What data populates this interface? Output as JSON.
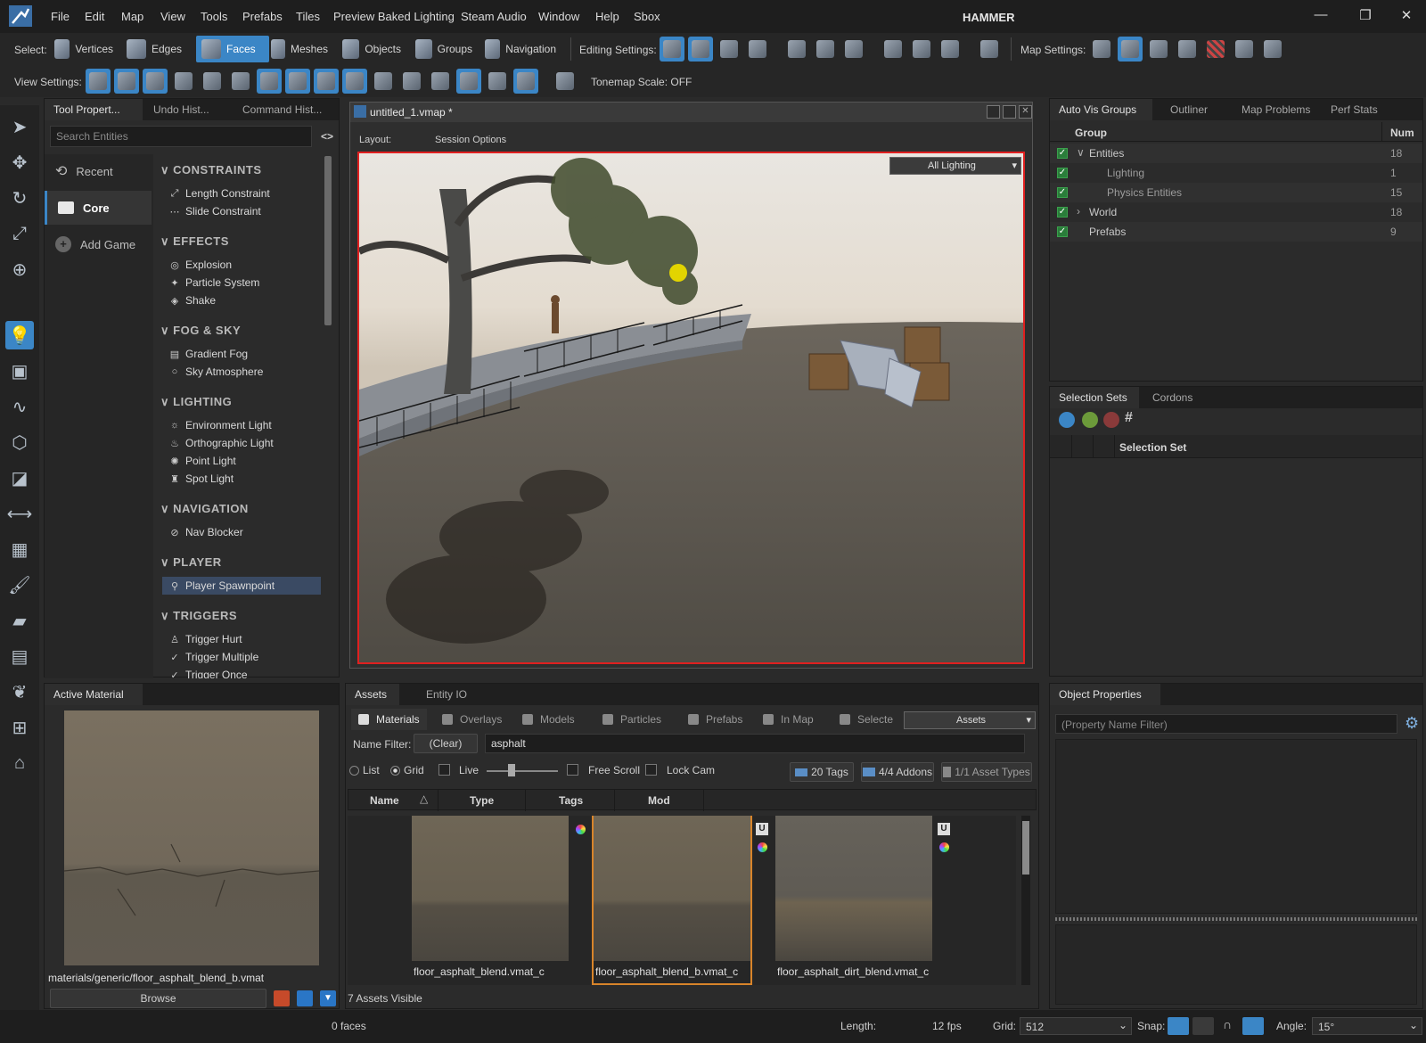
{
  "menubar": {
    "items": [
      "File",
      "Edit",
      "Map",
      "View",
      "Tools",
      "Prefabs",
      "Tiles",
      "Preview Baked Lighting",
      "Steam Audio",
      "Window",
      "Help",
      "Sbox"
    ],
    "title": "HAMMER",
    "win": {
      "min": "—",
      "max": "❐",
      "close": "✕"
    }
  },
  "toolbar1": {
    "select_label": "Select:",
    "select_modes": [
      {
        "label": "Vertices",
        "icon": "vertices-icon",
        "active": false
      },
      {
        "label": "Edges",
        "icon": "edges-icon",
        "active": false
      },
      {
        "label": "Faces",
        "icon": "faces-icon",
        "active": true
      },
      {
        "label": "Meshes",
        "icon": "meshes-icon",
        "active": false
      },
      {
        "label": "Objects",
        "icon": "objects-icon",
        "active": false
      },
      {
        "label": "Groups",
        "icon": "groups-icon",
        "active": false
      },
      {
        "label": "Navigation",
        "icon": "navigation-icon",
        "active": false
      }
    ],
    "editing_label": "Editing Settings:",
    "map_label": "Map Settings:"
  },
  "toolbar2": {
    "view_label": "View Settings:",
    "tonemap": "Tonemap Scale: OFF"
  },
  "left_panel": {
    "tabs": [
      "Tool Propert...",
      "Undo Hist...",
      "Command Hist..."
    ],
    "search_placeholder": "Search Entities",
    "categories": [
      {
        "label": "Recent",
        "icon": "clock-icon",
        "active": false
      },
      {
        "label": "Core",
        "icon": "folder-icon",
        "active": true
      },
      {
        "label": "Add Game",
        "icon": "plus-circle-icon",
        "active": false
      }
    ],
    "sections": [
      {
        "title": "CONSTRAINTS",
        "items": [
          {
            "label": "Length Constraint",
            "glyph": "⤢"
          },
          {
            "label": "Slide Constraint",
            "glyph": "⋯"
          }
        ]
      },
      {
        "title": "EFFECTS",
        "items": [
          {
            "label": "Explosion",
            "glyph": "◎"
          },
          {
            "label": "Particle System",
            "glyph": "✦"
          },
          {
            "label": "Shake",
            "glyph": "◈"
          }
        ]
      },
      {
        "title": "FOG & SKY",
        "items": [
          {
            "label": "Gradient Fog",
            "glyph": "▤"
          },
          {
            "label": "Sky Atmosphere",
            "glyph": "○"
          }
        ]
      },
      {
        "title": "LIGHTING",
        "items": [
          {
            "label": "Environment Light",
            "glyph": "☼"
          },
          {
            "label": "Orthographic Light",
            "glyph": "♨"
          },
          {
            "label": "Point Light",
            "glyph": "✺"
          },
          {
            "label": "Spot Light",
            "glyph": "♜"
          }
        ]
      },
      {
        "title": "NAVIGATION",
        "items": [
          {
            "label": "Nav Blocker",
            "glyph": "⊘"
          }
        ]
      },
      {
        "title": "PLAYER",
        "items": [
          {
            "label": "Player Spawnpoint",
            "glyph": "⚲"
          }
        ]
      },
      {
        "title": "TRIGGERS",
        "items": [
          {
            "label": "Trigger Hurt",
            "glyph": "♙"
          },
          {
            "label": "Trigger Multiple",
            "glyph": "✓"
          },
          {
            "label": "Trigger Once",
            "glyph": "✓"
          }
        ]
      }
    ]
  },
  "viewport": {
    "title": "untitled_1.vmap *",
    "layout_label": "Layout:",
    "session_options": "Session Options",
    "lighting_dropdown": "All Lighting"
  },
  "right_top": {
    "tabs": [
      "Auto Vis Groups",
      "Outliner",
      "Map Problems",
      "Perf Stats"
    ],
    "col_group": "Group",
    "col_num": "Num",
    "rows": [
      {
        "name": "Entities",
        "num": "18",
        "indent": 0,
        "expander": "∨"
      },
      {
        "name": "Lighting",
        "num": "1",
        "indent": 1,
        "expander": ""
      },
      {
        "name": "Physics Entities",
        "num": "15",
        "indent": 1,
        "expander": ""
      },
      {
        "name": "World",
        "num": "18",
        "indent": 0,
        "expander": "›"
      },
      {
        "name": "Prefabs",
        "num": "9",
        "indent": 0,
        "expander": ""
      }
    ]
  },
  "selection_sets": {
    "tabs": [
      "Selection Sets",
      "Cordons"
    ],
    "col": "Selection Set"
  },
  "active_material": {
    "tab": "Active Material",
    "path": "materials/generic/floor_asphalt_blend_b.vmat",
    "browse": "Browse"
  },
  "assets": {
    "tabs": [
      "Assets",
      "Entity IO"
    ],
    "subtabs": [
      {
        "label": "Materials",
        "icon": "image-icon",
        "active": true
      },
      {
        "label": "Overlays",
        "icon": "brush-icon",
        "active": false
      },
      {
        "label": "Models",
        "icon": "model-icon",
        "active": false
      },
      {
        "label": "Particles",
        "icon": "sparkle-icon",
        "active": false
      },
      {
        "label": "Prefabs",
        "icon": "prefab-icon",
        "active": false
      },
      {
        "label": "In Map",
        "icon": "pin-icon",
        "active": false
      },
      {
        "label": "Selecte",
        "icon": "select-icon",
        "active": false
      }
    ],
    "source_dropdown": "Assets",
    "name_filter_label": "Name Filter:",
    "clear": "(Clear)",
    "filter_value": "asphalt",
    "list": "List",
    "grid": "Grid",
    "live": "Live",
    "free_scroll": "Free Scroll",
    "lock_cam": "Lock Cam",
    "tags": "20 Tags",
    "addons": "4/4 Addons",
    "asset_types": "1/1 Asset Types",
    "columns": [
      "Name",
      "Type",
      "Tags",
      "Mod"
    ],
    "items": [
      {
        "name": "floor_asphalt_blend.vmat_c",
        "selected": false,
        "badge_u": false
      },
      {
        "name": "floor_asphalt_blend_b.vmat_c",
        "selected": true,
        "badge_u": true
      },
      {
        "name": "floor_asphalt_dirt_blend.vmat_c",
        "selected": false,
        "badge_u": true
      }
    ],
    "visible_count": "7 Assets Visible"
  },
  "object_properties": {
    "tab": "Object Properties",
    "filter_placeholder": "(Property Name Filter)"
  },
  "status": {
    "faces": "0 faces",
    "length_label": "Length:",
    "fps": "12 fps",
    "grid_label": "Grid:",
    "grid_value": "512",
    "snap_label": "Snap:",
    "angle_label": "Angle:",
    "angle_value": "15°"
  },
  "colors": {
    "accent": "#3b86c6",
    "selection_border": "#e02020",
    "asset_selected": "#d8842a"
  }
}
